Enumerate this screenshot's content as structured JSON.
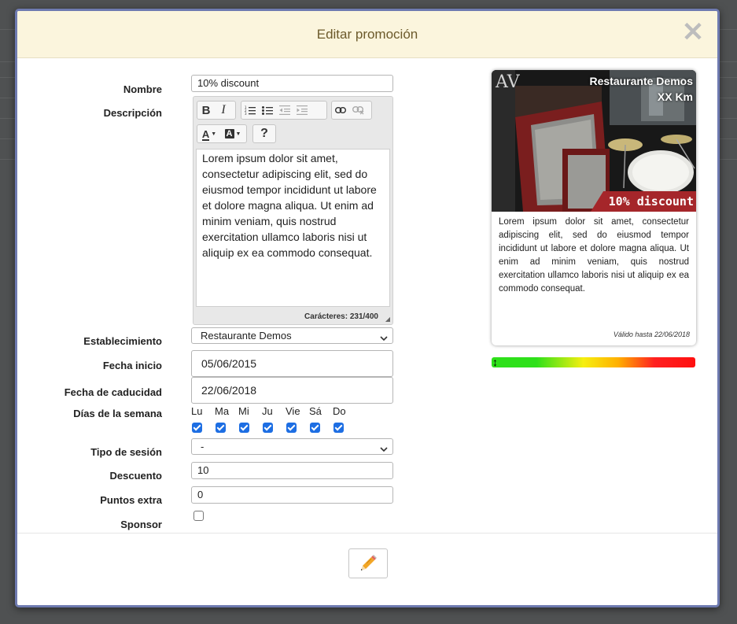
{
  "modal": {
    "title": "Editar promoción"
  },
  "labels": {
    "nombre": "Nombre",
    "descripcion": "Descripción",
    "establecimiento": "Establecimiento",
    "fecha_inicio": "Fecha inicio",
    "fecha_caducidad": "Fecha de caducidad",
    "dias_semana": "Días de la semana",
    "tipo_sesion": "Tipo de sesión",
    "descuento": "Descuento",
    "puntos_extra": "Puntos extra",
    "sponsor": "Sponsor"
  },
  "fields": {
    "nombre": "10% discount",
    "descripcion": "Lorem ipsum dolor sit amet, consectetur adipiscing elit, sed do eiusmod tempor incididunt ut labore et dolore magna aliqua. Ut enim ad minim veniam, quis nostrud exercitation ullamco laboris nisi ut aliquip ex ea commodo consequat.",
    "char_count": "Carácteres: 231/400",
    "establecimiento": "Restaurante Demos",
    "fecha_inicio": "05/06/2015",
    "fecha_caducidad": "22/06/2018",
    "tipo_sesion": "-",
    "descuento": "10",
    "puntos_extra": "0",
    "sponsor": false
  },
  "days": [
    {
      "label": "Lu",
      "checked": true
    },
    {
      "label": "Ma",
      "checked": true
    },
    {
      "label": "Mi",
      "checked": true
    },
    {
      "label": "Ju",
      "checked": true
    },
    {
      "label": "Vie",
      "checked": true
    },
    {
      "label": "Sá",
      "checked": true
    },
    {
      "label": "Do",
      "checked": true
    }
  ],
  "editor_toolbar": {
    "bold": "B",
    "italic": "I",
    "font_color": "A",
    "highlight": "A",
    "help": "?"
  },
  "preview": {
    "logo": "AV",
    "venue": "Restaurante Demos",
    "distance": "XX Km",
    "badge": "10% discount",
    "body": "Lorem ipsum dolor sit amet, consectetur adipiscing elit, sed do eiusmod tempor incididunt ut labore et dolore magna aliqua. Ut enim ad minim veniam, quis nostrud exercitation ullamco laboris nisi ut aliquip ex ea commodo consequat.",
    "valid_until": "Válido hasta 22/06/2018"
  },
  "gauge": {
    "level": 0
  },
  "colors": {
    "header_bg": "#fbf5dd",
    "title": "#6c5a2b",
    "checkbox": "#1d6ee3",
    "badge_bg": "#a5262a"
  }
}
